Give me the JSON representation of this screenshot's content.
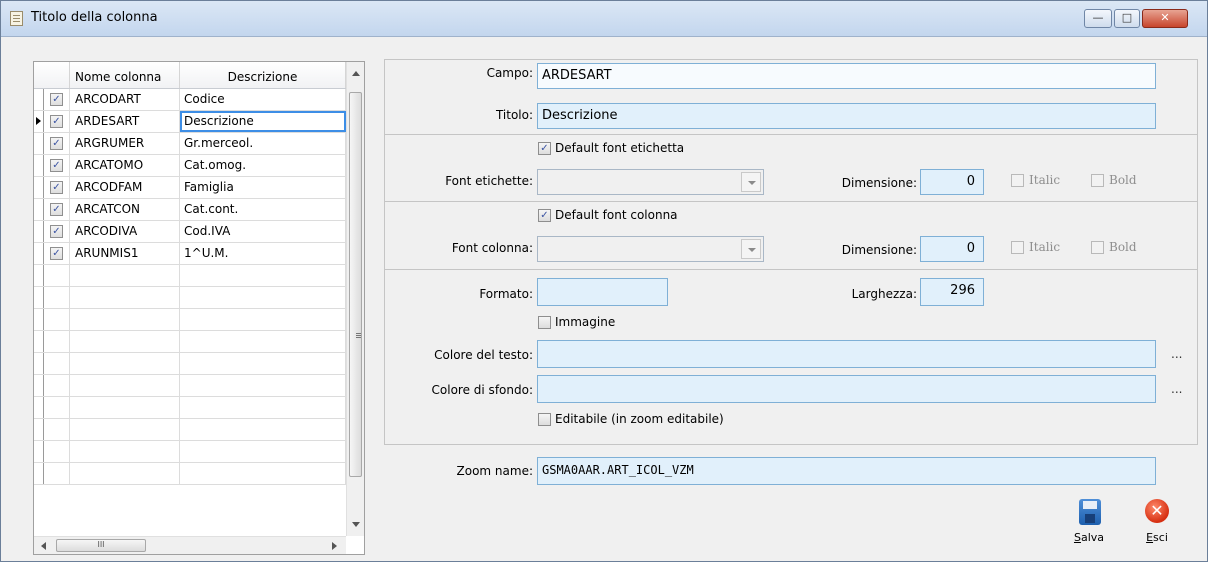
{
  "window": {
    "title": "Titolo della colonna",
    "min_glyph": "—",
    "max_glyph": "□",
    "close_glyph": "✕"
  },
  "grid": {
    "headers": {
      "nome": "Nome colonna",
      "descrizione": "Descrizione"
    },
    "rows": [
      {
        "checked": true,
        "nome": "ARCODART",
        "descrizione": "Codice"
      },
      {
        "checked": true,
        "nome": "ARDESART",
        "descrizione": "Descrizione"
      },
      {
        "checked": true,
        "nome": "ARGRUMER",
        "descrizione": "Gr.merceol."
      },
      {
        "checked": true,
        "nome": "ARCATOMO",
        "descrizione": "Cat.omog."
      },
      {
        "checked": true,
        "nome": "ARCODFAM",
        "descrizione": "Famiglia"
      },
      {
        "checked": true,
        "nome": "ARCATCON",
        "descrizione": "Cat.cont."
      },
      {
        "checked": true,
        "nome": "ARCODIVA",
        "descrizione": "Cod.IVA"
      },
      {
        "checked": true,
        "nome": "ARUNMIS1",
        "descrizione": "1^U.M."
      }
    ],
    "empty_rows": 10,
    "selected_row": 1,
    "check_glyph": "✓",
    "hscroll_thumb_glyph": "III"
  },
  "form": {
    "campo": {
      "label": "Campo:",
      "value": "ARDESART"
    },
    "titolo": {
      "label": "Titolo:",
      "value": "Descrizione"
    },
    "default_font_etichetta": {
      "label": "Default font etichetta",
      "checked": true
    },
    "font_etichette": {
      "label": "Font etichette:",
      "value": ""
    },
    "dimensione_etichetta": {
      "label": "Dimensione:",
      "value": "0"
    },
    "italic_etichetta": {
      "label": "Italic",
      "checked": false
    },
    "bold_etichetta": {
      "label": "Bold",
      "checked": false
    },
    "default_font_colonna": {
      "label": "Default font colonna",
      "checked": true
    },
    "font_colonna": {
      "label": "Font colonna:",
      "value": ""
    },
    "dimensione_colonna": {
      "label": "Dimensione:",
      "value": "0"
    },
    "italic_colonna": {
      "label": "Italic",
      "checked": false
    },
    "bold_colonna": {
      "label": "Bold",
      "checked": false
    },
    "formato": {
      "label": "Formato:",
      "value": ""
    },
    "larghezza": {
      "label": "Larghezza:",
      "value": "296"
    },
    "immagine": {
      "label": "Immagine",
      "checked": false
    },
    "colore_testo": {
      "label": "Colore del testo:",
      "value": "",
      "ellipsis": "..."
    },
    "colore_sfondo": {
      "label": "Colore di sfondo:",
      "value": "",
      "ellipsis": "..."
    },
    "editabile": {
      "label": "Editabile (in zoom editabile)",
      "checked": false
    },
    "zoom_name": {
      "label": "Zoom name:",
      "value": "GSMA0AAR.ART_ICOL_VZM"
    }
  },
  "actions": {
    "salva": "Salva",
    "esci": "Esci",
    "exit_glyph": "✕"
  },
  "colors": {
    "field_bg": "#e1f0fb",
    "field_border": "#7fb0d6",
    "selection": "#3d8ee6"
  }
}
